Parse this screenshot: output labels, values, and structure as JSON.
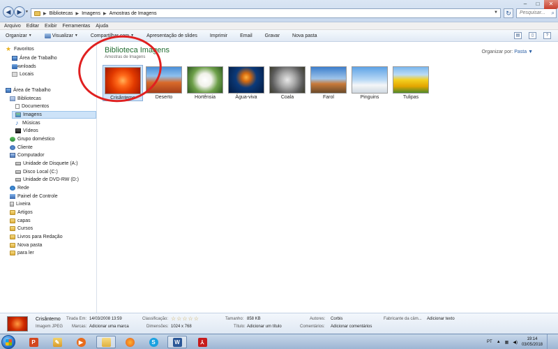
{
  "address": {
    "crumbs": [
      "Bibliotecas",
      "Imagens",
      "Amostras de Imagens"
    ]
  },
  "search": {
    "placeholder": "Pesquisar..."
  },
  "menu": [
    "Arquivo",
    "Editar",
    "Exibir",
    "Ferramentas",
    "Ajuda"
  ],
  "toolbar": {
    "organizar": "Organizar",
    "visualizar": "Visualizar",
    "compartilhar": "Compartilhar com",
    "apresentacao": "Apresentação de slides",
    "imprimir": "Imprimir",
    "email": "Email",
    "gravar": "Gravar",
    "nova_pasta": "Nova pasta"
  },
  "sidebar": {
    "favoritos": "Favoritos",
    "area_trabalho_fav": "Área de Trabalho",
    "downloads": "Downloads",
    "locais": "Locais",
    "area_trabalho": "Área de Trabalho",
    "bibliotecas": "Bibliotecas",
    "documentos": "Documentos",
    "imagens": "Imagens",
    "musicas": "Músicas",
    "videos": "Vídeos",
    "grupo": "Grupo doméstico",
    "cliente": "Cliente",
    "computador": "Computador",
    "disquete": "Unidade de Disquete (A:)",
    "disco": "Disco Local (C:)",
    "dvd": "Unidade de DVD-RW (D:)",
    "rede": "Rede",
    "painel": "Painel de Controle",
    "lixeira": "Lixeira",
    "folders": [
      "Artigos",
      "capas",
      "Cursos",
      "Livros para Redação",
      "Nova pasta",
      "para ler"
    ]
  },
  "main": {
    "title": "Biblioteca Imagens",
    "subtitle": "Amostras de Imagens",
    "arrange_label": "Organizar por:",
    "arrange_value": "Pasta",
    "thumbnails": [
      "Crisântemo",
      "Deserto",
      "Hortênsia",
      "Água-viva",
      "Coala",
      "Farol",
      "Pinguins",
      "Tulipas"
    ]
  },
  "details": {
    "name": "Crisântemo",
    "type": "Imagem JPEG",
    "tirada_label": "Tirada Em:",
    "tirada_value": "14/03/2008 13:59",
    "marcas_label": "Marcas:",
    "marcas_value": "Adicionar uma marca",
    "class_label": "Classificação:",
    "dim_label": "Dimensões:",
    "dim_value": "1024 x 768",
    "tamanho_label": "Tamanho:",
    "tamanho_value": "858 KB",
    "titulo_label": "Título:",
    "titulo_value": "Adicionar um título",
    "autores_label": "Autores:",
    "autores_value": "Corbis",
    "coment_label": "Comentários:",
    "coment_value": "Adicionar comentários",
    "fab_label": "Fabricante da câm...",
    "fab_value": "Adicionar texto",
    "rating": 0
  },
  "taskbar": {
    "lang": "PT",
    "time": "19:14",
    "date": "03/05/2018"
  }
}
